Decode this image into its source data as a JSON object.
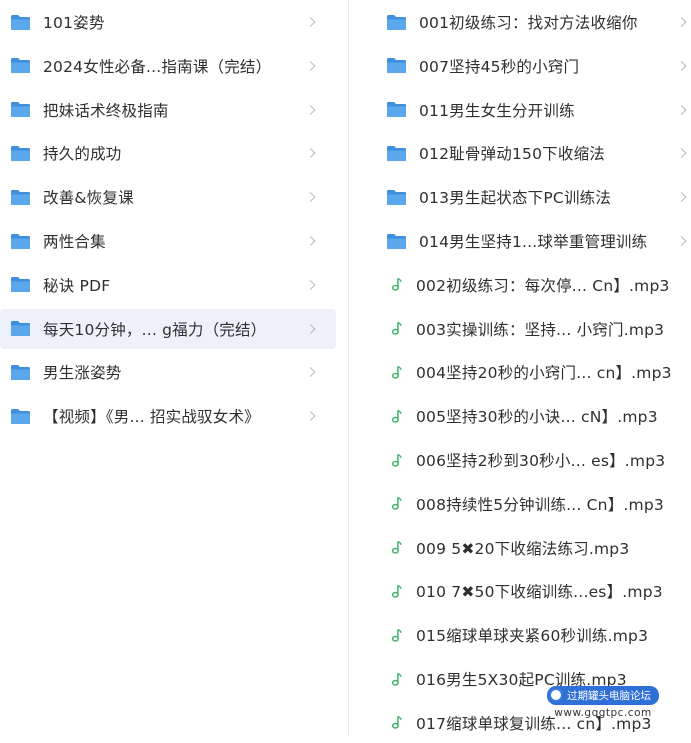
{
  "left_list": {
    "items": [
      {
        "label": "101姿势",
        "type": "folder"
      },
      {
        "label": "2024女性必备...指南课（完结）",
        "type": "folder"
      },
      {
        "label": "把妹话术终极指南",
        "type": "folder"
      },
      {
        "label": "持久的成功",
        "type": "folder"
      },
      {
        "label": "改善&恢复课",
        "type": "folder"
      },
      {
        "label": "两性合集",
        "type": "folder"
      },
      {
        "label": "秘诀 PDF",
        "type": "folder"
      },
      {
        "label": "每天10分钟，... g福力（完结）",
        "type": "folder",
        "selected": true
      },
      {
        "label": "男生涨姿势",
        "type": "folder"
      },
      {
        "label": "【视频】《男... 招实战驭女术》",
        "type": "folder"
      }
    ]
  },
  "right_list": {
    "items": [
      {
        "label": "001初级练习：找对方法收缩你",
        "type": "folder"
      },
      {
        "label": "007坚持45秒的小窍门",
        "type": "folder"
      },
      {
        "label": "011男生女生分开训练",
        "type": "folder"
      },
      {
        "label": "012耻骨弹动150下收缩法",
        "type": "folder"
      },
      {
        "label": "013男生起状态下PC训练法",
        "type": "folder"
      },
      {
        "label": "014男生坚持1...球举重管理训练",
        "type": "folder"
      },
      {
        "label": "002初级练习：每次停... Cn】.mp3",
        "type": "audio"
      },
      {
        "label": "003实操训练：坚持... 小窍门.mp3",
        "type": "audio"
      },
      {
        "label": "004坚持20秒的小窍门... cn】.mp3",
        "type": "audio"
      },
      {
        "label": "005坚持30秒的小诀... cN】.mp3",
        "type": "audio"
      },
      {
        "label": "006坚持2秒到30秒小... es】.mp3",
        "type": "audio"
      },
      {
        "label": "008持续性5分钟训练... Cn】.mp3",
        "type": "audio"
      },
      {
        "label": "009 5✖20下收缩法练习.mp3",
        "type": "audio"
      },
      {
        "label": "010 7✖50下收缩训练...es】.mp3",
        "type": "audio"
      },
      {
        "label": "015缩球单球夹紧60秒训练.mp3",
        "type": "audio"
      },
      {
        "label": "016男生5X30起PC训练.mp3",
        "type": "audio"
      },
      {
        "label": "017缩球单球复训练... cn】.mp3",
        "type": "audio"
      }
    ]
  },
  "watermark": {
    "site_name": "过期罐头电脑论坛",
    "url": "www.gqgtpc.com"
  },
  "colors": {
    "folder": "#5aa7ec",
    "folder_tab": "#3f8fdc",
    "audio_icon": "#3eb36a",
    "selected_bg": "#eef1fb",
    "watermark_bar": "#2f6fd8"
  }
}
